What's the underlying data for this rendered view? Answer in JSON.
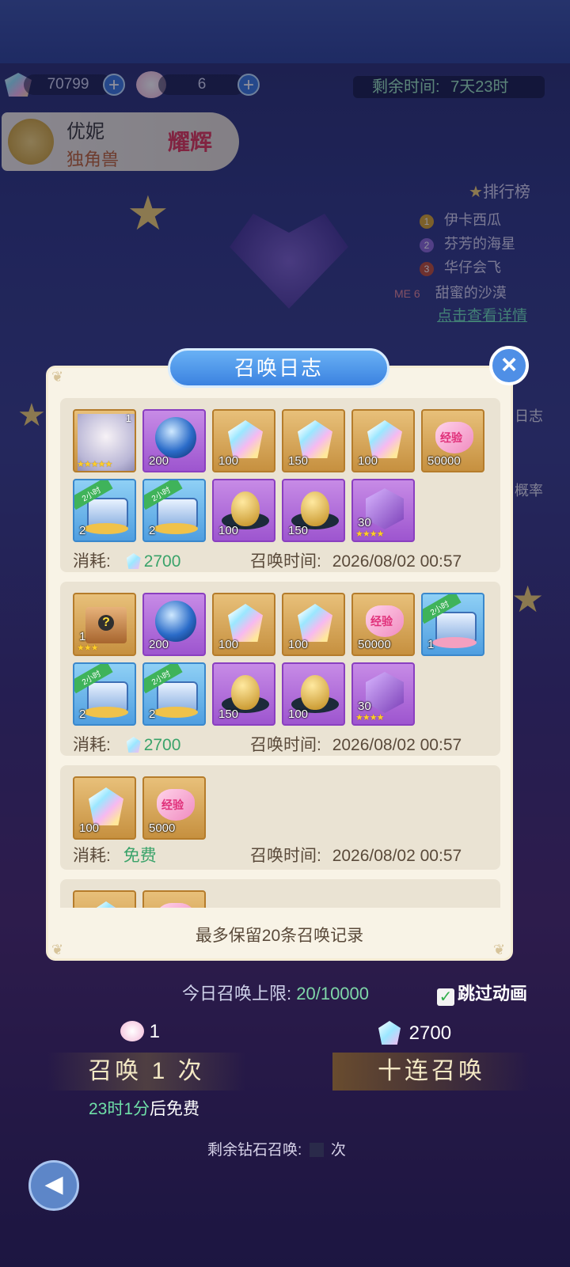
{
  "header": {
    "diamond_count": "70799",
    "ticket_count": "6",
    "remaining_time_label": "剩余时间:",
    "remaining_time_value": "7天23时"
  },
  "character": {
    "name": "优妮",
    "type": "独角兽",
    "badge": "耀辉"
  },
  "leaderboard": {
    "title": "排行榜",
    "entries": [
      {
        "rank": "1",
        "name": "伊卡西瓜"
      },
      {
        "rank": "2",
        "name": "芬芳的海星"
      },
      {
        "rank": "3",
        "name": "华仔会飞"
      },
      {
        "rank": "ME 6",
        "name": "甜蜜的沙漠"
      }
    ],
    "details_link": "点击查看详情"
  },
  "side_buttons": {
    "log_partial": "日志",
    "prob_partial": "概率"
  },
  "modal": {
    "title": "召唤日志",
    "footer": "最多保留20条召唤记录",
    "cost_label": "消耗:",
    "time_label": "召唤时间:",
    "entries": [
      {
        "cost": "2700",
        "time": "2026/08/02 00:57",
        "items": [
          {
            "kind": "avatar",
            "qty": "1",
            "stars": "★★★★★"
          },
          {
            "kind": "orb",
            "qty": "200"
          },
          {
            "kind": "gem",
            "qty": "100"
          },
          {
            "kind": "gem",
            "qty": "150"
          },
          {
            "kind": "gem",
            "qty": "100"
          },
          {
            "kind": "heart",
            "qty": "50000",
            "text": "经验"
          },
          {
            "kind": "chest",
            "qty": "2",
            "tag": "2小时"
          },
          {
            "kind": "chest",
            "qty": "2",
            "tag": "2小时"
          },
          {
            "kind": "egg",
            "qty": "100"
          },
          {
            "kind": "egg",
            "qty": "150"
          },
          {
            "kind": "cube",
            "qty": "30",
            "stars": "★★★★"
          }
        ]
      },
      {
        "cost": "2700",
        "time": "2026/08/02 00:57",
        "items": [
          {
            "kind": "box",
            "qty": "1",
            "stars": "★★★"
          },
          {
            "kind": "orb",
            "qty": "200"
          },
          {
            "kind": "gem",
            "qty": "100"
          },
          {
            "kind": "gem",
            "qty": "100"
          },
          {
            "kind": "heart",
            "qty": "50000",
            "text": "经验"
          },
          {
            "kind": "chest",
            "qty": "1",
            "tag": "2小时"
          },
          {
            "kind": "chest",
            "qty": "2",
            "tag": "2小时"
          },
          {
            "kind": "chest",
            "qty": "2",
            "tag": "2小时"
          },
          {
            "kind": "egg",
            "qty": "150"
          },
          {
            "kind": "egg",
            "qty": "100"
          },
          {
            "kind": "cube",
            "qty": "30",
            "stars": "★★★★"
          }
        ]
      },
      {
        "cost": "免费",
        "time": "2026/08/02 00:57",
        "items": [
          {
            "kind": "gem",
            "qty": "100"
          },
          {
            "kind": "heart",
            "qty": "5000",
            "text": "经验"
          }
        ]
      }
    ]
  },
  "bottom": {
    "daily_limit_label": "今日召唤上限:",
    "daily_limit_value": "20/10000",
    "skip_animation": "跳过动画",
    "single_cost": "1",
    "ten_cost": "2700",
    "summon_once": "召唤 1 次",
    "summon_ten": "十连召唤",
    "free_timer": "23时1分",
    "free_suffix": "后免费",
    "remaining_label": "剩余钻石召唤:",
    "remaining_suffix": "次"
  },
  "colors": {
    "accent_blue": "#3b82e0",
    "cost_green": "#3aa36a",
    "panel_bg": "#f8f3e6"
  }
}
